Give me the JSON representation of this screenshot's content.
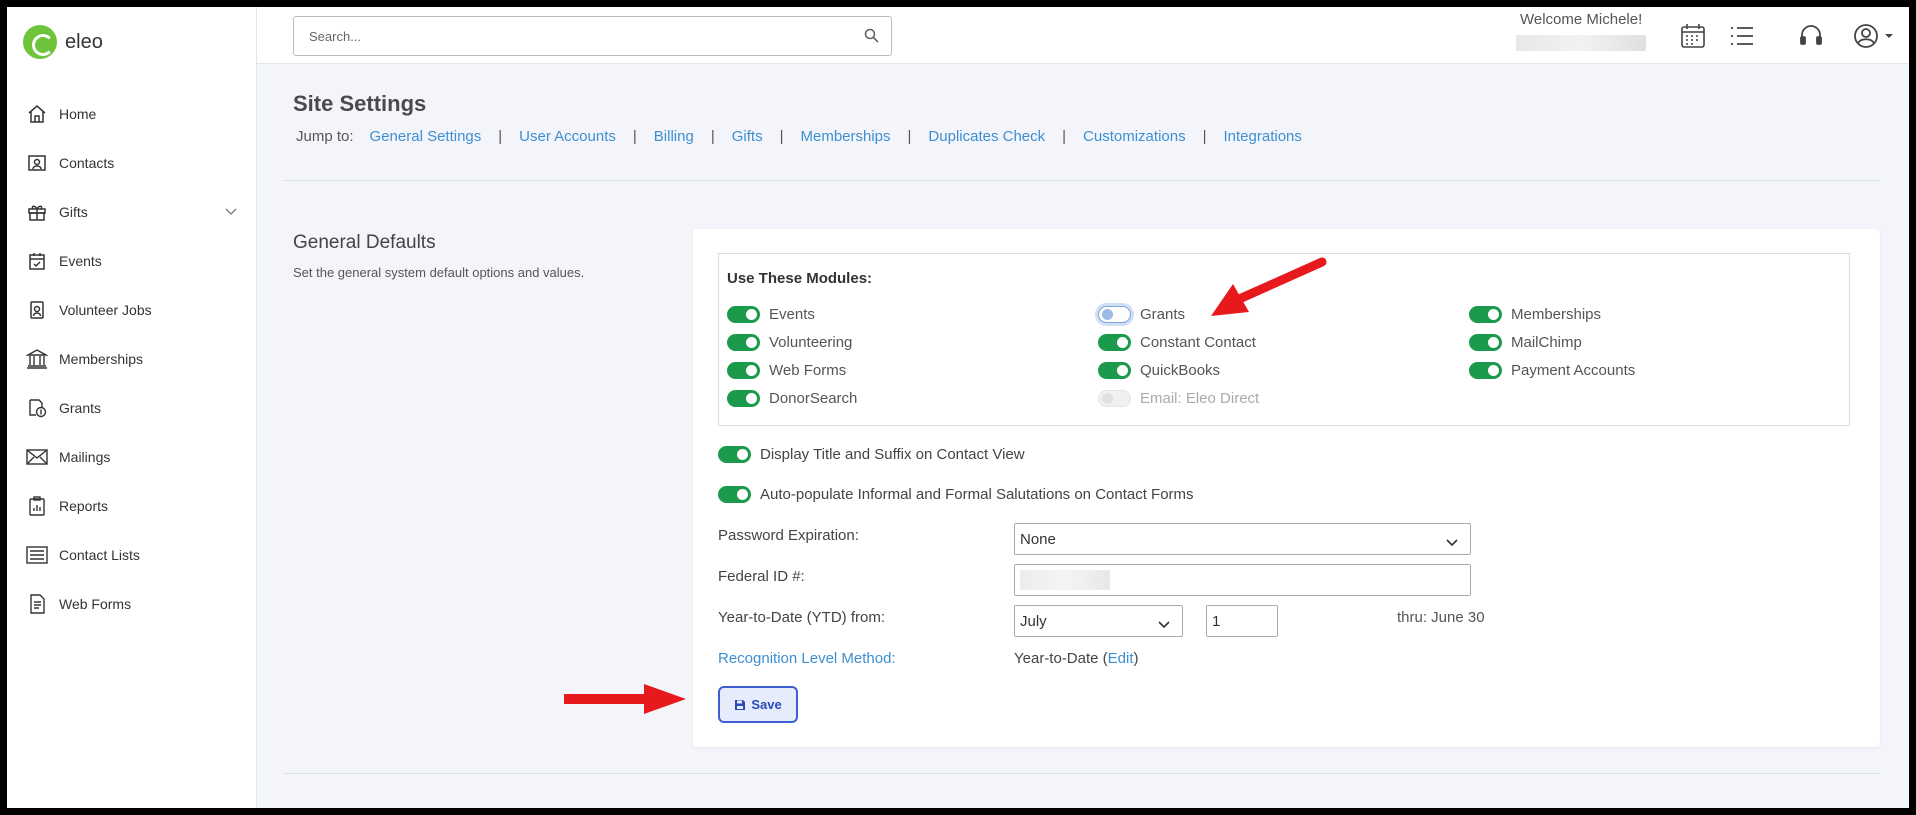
{
  "brand": {
    "name": "eleo"
  },
  "sidebar": {
    "items": [
      {
        "label": "Home",
        "icon": "home-icon"
      },
      {
        "label": "Contacts",
        "icon": "contacts-icon"
      },
      {
        "label": "Gifts",
        "icon": "gift-icon",
        "expandable": true
      },
      {
        "label": "Events",
        "icon": "calendar-icon"
      },
      {
        "label": "Volunteer Jobs",
        "icon": "badge-icon"
      },
      {
        "label": "Memberships",
        "icon": "building-icon"
      },
      {
        "label": "Grants",
        "icon": "money-document-icon"
      },
      {
        "label": "Mailings",
        "icon": "envelope-icon"
      },
      {
        "label": "Reports",
        "icon": "report-icon"
      },
      {
        "label": "Contact Lists",
        "icon": "list-icon"
      },
      {
        "label": "Web Forms",
        "icon": "form-icon"
      }
    ]
  },
  "topbar": {
    "search_placeholder": "Search...",
    "welcome": "Welcome Michele!"
  },
  "page": {
    "title": "Site Settings",
    "jump_label": "Jump to:",
    "jump_links": [
      "General Settings",
      "User Accounts",
      "Billing",
      "Gifts",
      "Memberships",
      "Duplicates Check",
      "Customizations",
      "Integrations"
    ]
  },
  "section": {
    "title": "General Defaults",
    "description": "Set the general system default options and values."
  },
  "modules": {
    "title": "Use These Modules:",
    "items": [
      {
        "label": "Events",
        "state": "on"
      },
      {
        "label": "Volunteering",
        "state": "on"
      },
      {
        "label": "Web Forms",
        "state": "on"
      },
      {
        "label": "DonorSearch",
        "state": "on"
      },
      {
        "label": "Grants",
        "state": "off"
      },
      {
        "label": "Constant Contact",
        "state": "on"
      },
      {
        "label": "QuickBooks",
        "state": "on"
      },
      {
        "label": "Email: Eleo Direct",
        "state": "disabled"
      },
      {
        "label": "Memberships",
        "state": "on"
      },
      {
        "label": "MailChimp",
        "state": "on"
      },
      {
        "label": "Payment Accounts",
        "state": "on"
      }
    ]
  },
  "options": {
    "display_title": "Display Title and Suffix on Contact View",
    "auto_populate": "Auto-populate Informal and Formal Salutations on Contact Forms"
  },
  "form": {
    "password_label": "Password Expiration:",
    "password_value": "None",
    "federal_label": "Federal ID #:",
    "ytd_label": "Year-to-Date (YTD) from:",
    "ytd_month": "July",
    "ytd_day": "1",
    "thru": "thru: June 30",
    "recognition_label": "Recognition Level Method:",
    "recognition_value": "Year-to-Date",
    "recognition_edit": "Edit"
  },
  "save_label": "Save",
  "colors": {
    "accent": "#3d8fd1",
    "toggle_on": "#1b9a4b",
    "annotation_arrow": "#e8191c"
  }
}
